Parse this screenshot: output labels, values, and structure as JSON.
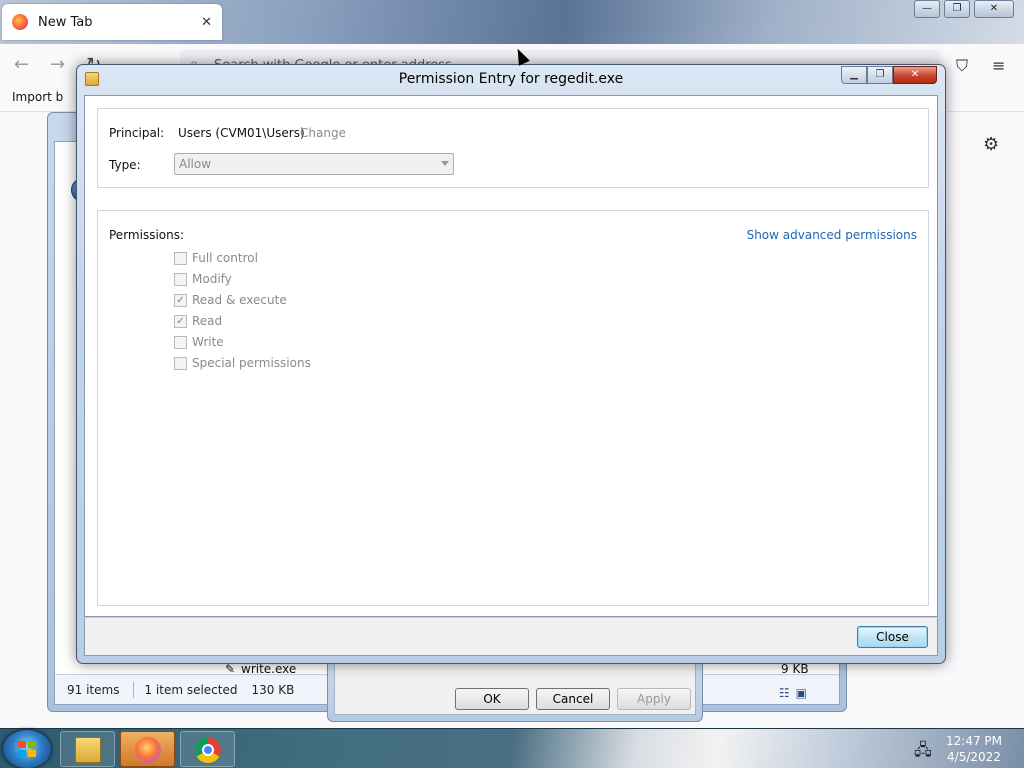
{
  "browser": {
    "tab_title": "New Tab",
    "tab_close": "✕",
    "url_placeholder": "Search with Google or enter address",
    "bookmark_import": "Import b",
    "controls": {
      "minimize": "—",
      "restore": "❐",
      "close": "✕"
    }
  },
  "explorer": {
    "status_items": "91 items",
    "status_selected": "1 item selected",
    "status_size": "130 KB",
    "file_name": "write.exe",
    "file_size": "9 KB"
  },
  "properties": {
    "ok_label": "OK",
    "cancel_label": "Cancel",
    "apply_label": "Apply"
  },
  "dialog": {
    "title": "Permission Entry for regedit.exe",
    "controls": {
      "minimize": "▁",
      "restore": "❐",
      "close": "✕"
    },
    "principal_label": "Principal:",
    "principal_value": "Users (CVM01\\Users)",
    "principal_change": "Change",
    "type_label": "Type:",
    "type_value": "Allow",
    "permissions_label": "Permissions:",
    "advanced_link": "Show advanced permissions",
    "permissions": [
      {
        "label": "Full control",
        "checked": false
      },
      {
        "label": "Modify",
        "checked": false
      },
      {
        "label": "Read & execute",
        "checked": true
      },
      {
        "label": "Read",
        "checked": true
      },
      {
        "label": "Write",
        "checked": false
      },
      {
        "label": "Special permissions",
        "checked": false
      }
    ],
    "close_label": "Close"
  },
  "taskbar": {
    "time": "12:47 PM",
    "date": "4/5/2022"
  }
}
